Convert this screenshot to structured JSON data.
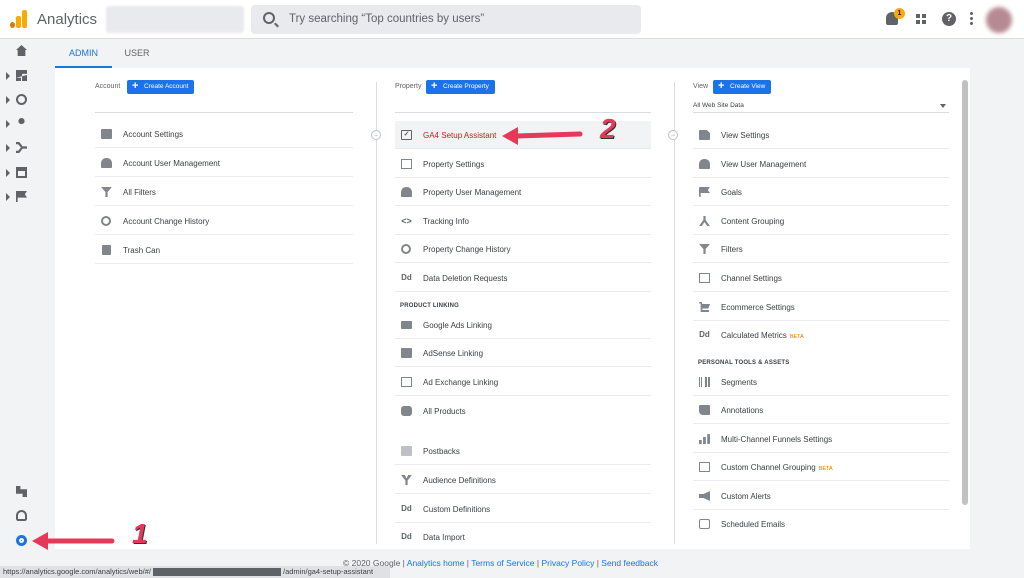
{
  "header": {
    "app_title": "Analytics",
    "search_placeholder": "Try searching “Top countries by users”",
    "notification_count": "1",
    "help_glyph": "?"
  },
  "icons": {
    "logo": "analytics-logo-icon",
    "search": "search-icon",
    "bell": "bell-icon",
    "apps": "apps-grid-icon",
    "help": "help-icon",
    "more": "more-vert-icon",
    "settings": "gear-icon"
  },
  "colors": {
    "accent": "#1a73e8",
    "logo_orange": "#f9ab00",
    "logo_dark": "#e37400",
    "highlight_text": "#c5221f",
    "annotation": "#e8385a"
  },
  "tabs": [
    {
      "label": "ADMIN"
    },
    {
      "label": "USER"
    }
  ],
  "account": {
    "label": "Account",
    "create": "Create Account",
    "items": [
      {
        "label": "Account Settings"
      },
      {
        "label": "Account User Management"
      },
      {
        "label": "All Filters"
      },
      {
        "label": "Account Change History"
      },
      {
        "label": "Trash Can"
      }
    ]
  },
  "property": {
    "label": "Property",
    "create": "Create Property",
    "items": [
      {
        "label": "GA4 Setup Assistant"
      },
      {
        "label": "Property Settings"
      },
      {
        "label": "Property User Management"
      },
      {
        "label": "Tracking Info"
      },
      {
        "label": "Property Change History"
      },
      {
        "label": "Data Deletion Requests"
      }
    ],
    "product_linking_title": "PRODUCT LINKING",
    "linking_items": [
      {
        "label": "Google Ads Linking"
      },
      {
        "label": "AdSense Linking"
      },
      {
        "label": "Ad Exchange Linking"
      },
      {
        "label": "All Products"
      }
    ],
    "more_items": [
      {
        "label": "Postbacks"
      },
      {
        "label": "Audience Definitions"
      },
      {
        "label": "Custom Definitions"
      },
      {
        "label": "Data Import"
      }
    ]
  },
  "view": {
    "label": "View",
    "create": "Create View",
    "selected": "All Web Site Data",
    "items": [
      {
        "label": "View Settings"
      },
      {
        "label": "View User Management"
      },
      {
        "label": "Goals"
      },
      {
        "label": "Content Grouping"
      },
      {
        "label": "Filters"
      },
      {
        "label": "Channel Settings"
      },
      {
        "label": "Ecommerce Settings"
      },
      {
        "label": "Calculated Metrics",
        "badge": "BETA"
      }
    ],
    "personal_title": "PERSONAL TOOLS & ASSETS",
    "personal_items": [
      {
        "label": "Segments"
      },
      {
        "label": "Annotations"
      },
      {
        "label": "Multi-Channel Funnels Settings"
      },
      {
        "label": "Custom Channel Grouping",
        "badge": "BETA"
      },
      {
        "label": "Custom Alerts"
      },
      {
        "label": "Scheduled Emails"
      }
    ]
  },
  "footer": {
    "copyright": "© 2020 Google",
    "links": [
      "Analytics home",
      "Terms of Service",
      "Privacy Policy",
      "Send feedback"
    ],
    "sep": " | "
  },
  "statusbar": {
    "url_start": "https://analytics.google.com/analytics/web/#/",
    "url_end": "/admin/ga4-setup-assistant"
  },
  "annotations": {
    "step1": "1",
    "step2": "2"
  },
  "icon_glyphs": {
    "dd": "Dd",
    "code": "<>"
  }
}
